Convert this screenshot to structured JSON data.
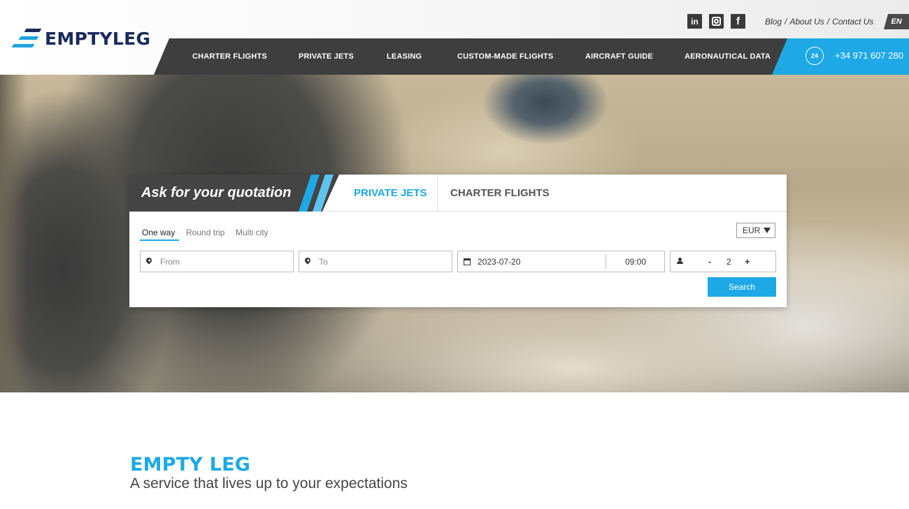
{
  "brand": {
    "name": "EMPTYLEG"
  },
  "social": {
    "linkedin": "in",
    "instagram": "",
    "facebook": "f"
  },
  "toplinks": {
    "blog": "Blog",
    "about": "About Us",
    "contact": "Contact Us",
    "separator": "/"
  },
  "language": "EN",
  "nav": {
    "items": [
      {
        "label": "CHARTER FLIGHTS"
      },
      {
        "label": "PRIVATE JETS"
      },
      {
        "label": "LEASING"
      },
      {
        "label": "CUSTOM-MADE FLIGHTS"
      },
      {
        "label": "AIRCRAFT GUIDE"
      },
      {
        "label": "AERONAUTICAL DATA"
      }
    ]
  },
  "phone": {
    "icon_text": "24",
    "number": "+34 971 607 280"
  },
  "quote": {
    "title": "Ask for your quotation",
    "tabs": [
      {
        "label": "PRIVATE JETS",
        "active": true
      },
      {
        "label": "CHARTER FLIGHTS",
        "active": false
      }
    ],
    "trip_types": [
      {
        "label": "One way",
        "active": true
      },
      {
        "label": "Round trip",
        "active": false
      },
      {
        "label": "Multi city",
        "active": false
      }
    ],
    "currency": "EUR",
    "from_placeholder": "From",
    "to_placeholder": "To",
    "date": "2023-07-20",
    "time": "09:00",
    "passengers": {
      "minus": "-",
      "count": "2",
      "plus": "+"
    },
    "search_label": "Search"
  },
  "section": {
    "title": "EMPTY LEG",
    "subtitle": "A service that lives up to your expectations"
  },
  "colors": {
    "accent": "#1ea9e6",
    "navy": "#1a2a5c",
    "nav_bg": "#3e3e3e"
  }
}
